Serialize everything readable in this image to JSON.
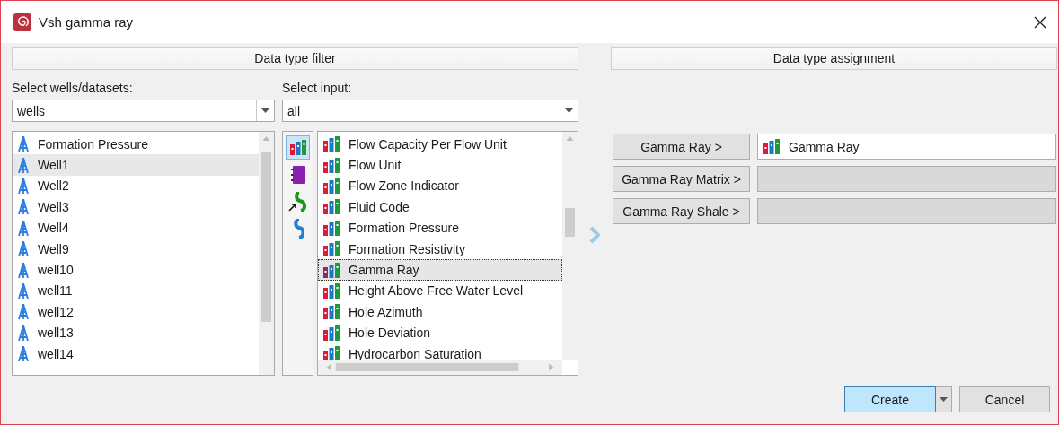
{
  "window": {
    "title": "Vsh gamma ray"
  },
  "filter_header": "Data type filter",
  "assignment_header": "Data type assignment",
  "wells_label": "Select wells/datasets:",
  "wells_combo": {
    "value": "wells"
  },
  "input_label": "Select input:",
  "input_combo": {
    "value": "all"
  },
  "wells": [
    {
      "name": "Formation Pressure",
      "selected": false
    },
    {
      "name": "Well1",
      "selected": true
    },
    {
      "name": "Well2",
      "selected": false
    },
    {
      "name": "Well3",
      "selected": false
    },
    {
      "name": "Well4",
      "selected": false
    },
    {
      "name": "Well9",
      "selected": false
    },
    {
      "name": "well10",
      "selected": false
    },
    {
      "name": "well11",
      "selected": false
    },
    {
      "name": "well12",
      "selected": false
    },
    {
      "name": "well13",
      "selected": false
    },
    {
      "name": "well14",
      "selected": false
    }
  ],
  "input_types": [
    {
      "kind": "logs",
      "selected": true
    },
    {
      "kind": "notebook",
      "selected": false
    },
    {
      "kind": "curve-link",
      "selected": false
    },
    {
      "kind": "curve",
      "selected": false
    }
  ],
  "inputs": [
    {
      "name": "Flow Capacity Per Flow Unit",
      "selected": false
    },
    {
      "name": "Flow Unit",
      "selected": false
    },
    {
      "name": "Flow Zone Indicator",
      "selected": false
    },
    {
      "name": "Fluid Code",
      "selected": false
    },
    {
      "name": "Formation Pressure",
      "selected": false
    },
    {
      "name": "Formation Resistivity",
      "selected": false
    },
    {
      "name": "Gamma Ray",
      "selected": true
    },
    {
      "name": "Height Above Free Water Level",
      "selected": false
    },
    {
      "name": "Hole Azimuth",
      "selected": false
    },
    {
      "name": "Hole Deviation",
      "selected": false
    },
    {
      "name": "Hydrocarbon Saturation",
      "selected": false
    }
  ],
  "assignments": [
    {
      "button": "Gamma Ray >",
      "value": "Gamma Ray"
    },
    {
      "button": "Gamma Ray Matrix >"
    },
    {
      "button": "Gamma Ray Shale >"
    }
  ],
  "buttons": {
    "primary": "Create",
    "cancel": "Cancel"
  }
}
